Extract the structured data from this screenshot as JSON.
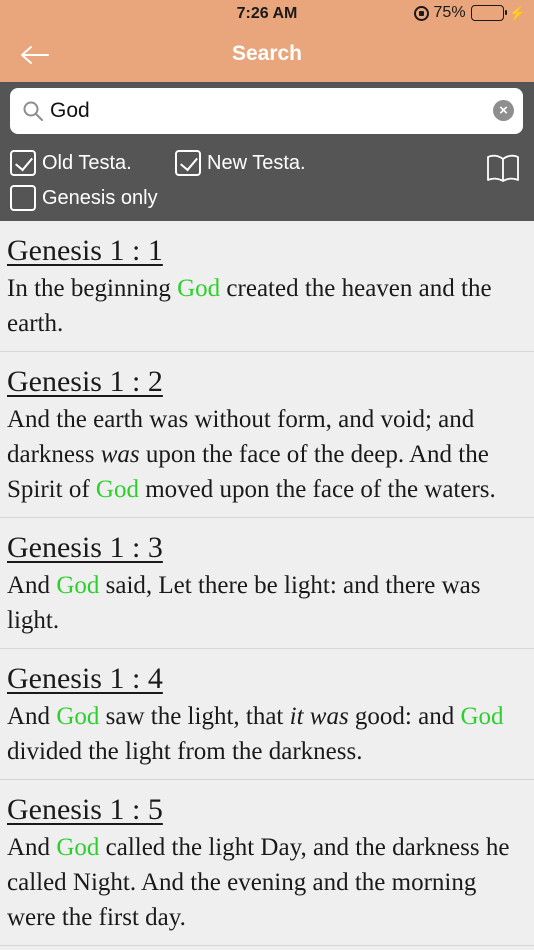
{
  "status_bar": {
    "time": "7:26 AM",
    "battery_percent": "75%",
    "battery_level": 0.75,
    "battery_color": "#4cd964"
  },
  "nav": {
    "title": "Search",
    "back_icon": "arrow-left-icon",
    "background": "#e9a67c"
  },
  "search": {
    "value": "God",
    "placeholder": "",
    "clear_icon": "clear-icon"
  },
  "options": {
    "old_testament": {
      "label": "Old Testa.",
      "checked": true
    },
    "new_testament": {
      "label": "New Testa.",
      "checked": true
    },
    "book_only": {
      "label": "Genesis only",
      "checked": false
    },
    "book_icon": "open-book-icon"
  },
  "highlight_color": "#2cd02c",
  "results": [
    {
      "reference": "Genesis 1 : 1",
      "parts": [
        {
          "t": " In the beginning "
        },
        {
          "t": "God",
          "h": true
        },
        {
          "t": " created the heaven and the earth."
        }
      ]
    },
    {
      "reference": "Genesis 1 : 2",
      "parts": [
        {
          "t": " And the earth was without form, and void; and darkness "
        },
        {
          "t": "was",
          "i": true
        },
        {
          "t": " upon the face of the deep. And the Spirit of "
        },
        {
          "t": "God",
          "h": true
        },
        {
          "t": " moved upon the face of the waters."
        }
      ]
    },
    {
      "reference": "Genesis 1 : 3",
      "parts": [
        {
          "t": " And "
        },
        {
          "t": "God",
          "h": true
        },
        {
          "t": " said, Let there be light: and there was light."
        }
      ]
    },
    {
      "reference": "Genesis 1 : 4",
      "parts": [
        {
          "t": " And "
        },
        {
          "t": "God",
          "h": true
        },
        {
          "t": " saw the light, that "
        },
        {
          "t": "it was",
          "i": true
        },
        {
          "t": " good: and "
        },
        {
          "t": "God",
          "h": true
        },
        {
          "t": " divided the light from the darkness."
        }
      ]
    },
    {
      "reference": "Genesis 1 : 5",
      "parts": [
        {
          "t": " And "
        },
        {
          "t": "God",
          "h": true
        },
        {
          "t": " called the light Day, and the darkness he called Night. And the evening and the morning were the first day."
        }
      ]
    }
  ]
}
